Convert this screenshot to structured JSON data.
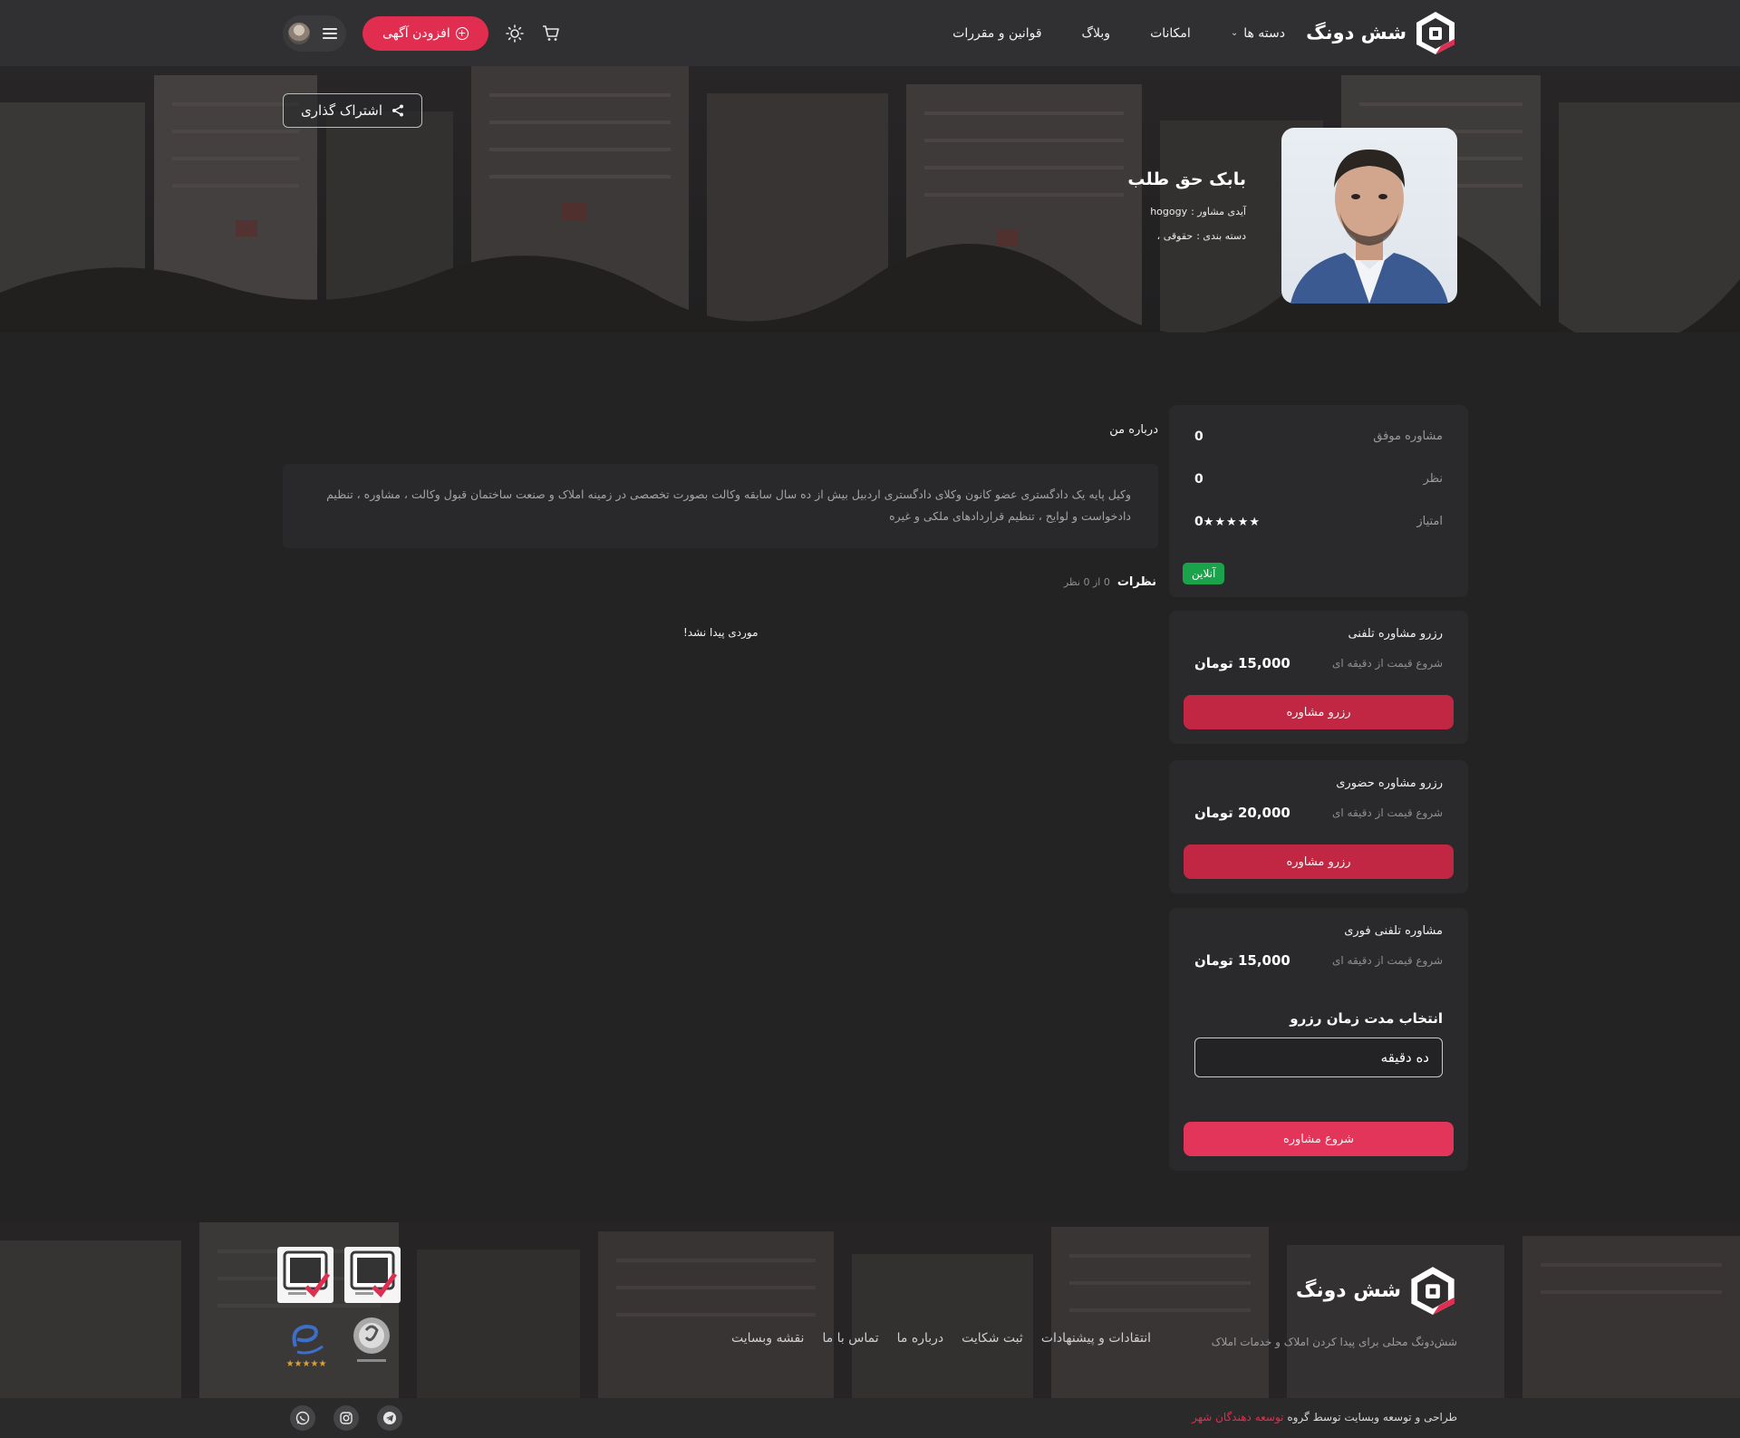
{
  "header": {
    "logo_text": "شش دونگ",
    "nav": [
      {
        "label": "دسته ها"
      },
      {
        "label": "امکانات"
      },
      {
        "label": "وبلاگ"
      },
      {
        "label": "قوانین و مقررات"
      }
    ],
    "add_ad_label": "افزودن آگهی"
  },
  "hero": {
    "share_label": "اشتراک گذاری",
    "name": "بابک حق طلب",
    "advisor_id_label": "آیدی مشاور :",
    "advisor_id": "hogogy",
    "category_label": "دسته بندی :",
    "category": "حقوقی ،"
  },
  "stats": {
    "successful_label": "مشاوره موفق",
    "successful_value": "0",
    "reviews_label": "نظر",
    "reviews_value": "0",
    "rating_label": "امتیاز",
    "rating_value": "0",
    "rating_stars": "★★★★★",
    "status": "آنلاین"
  },
  "booking": [
    {
      "title": "رزرو مشاوره تلفنی",
      "price_label": "شروع قیمت از دقیقه ای",
      "price": "15,000 تومان",
      "button": "رزرو مشاوره"
    },
    {
      "title": "رزرو مشاوره حضوری",
      "price_label": "شروع قیمت از دقیقه ای",
      "price": "20,000 تومان",
      "button": "رزرو مشاوره"
    }
  ],
  "instant": {
    "title": "مشاوره تلفنی فوری",
    "price_label": "شروع قیمت از دقیقه ای",
    "price": "15,000 تومان",
    "select_title": "انتخاب مدت زمان رزرو",
    "selected_duration": "ده دقیقه",
    "button": "شروع مشاوره"
  },
  "about": {
    "title": "درباره من",
    "text": "وکیل پایه یک دادگستری عضو کانون وکلای دادگستری اردبیل بیش از ده سال سابقه وکالت بصورت تخصصی در زمینه املاک و صنعت ساختمان قبول وکالت ، مشاوره ، تنظیم دادخواست و لوایح ، تنظیم قراردادهای ملکی و غیره"
  },
  "reviews": {
    "title": "نظرات",
    "count": "0 از 0 نظر",
    "empty": "موردی پیدا نشد!"
  },
  "footer": {
    "logo_text": "شش دونگ",
    "tagline": "شش‌دونگ محلی برای پیدا کردن املاک و خدمات املاک",
    "links": [
      "انتقادات و پیشنهادات",
      "ثبت شکایت",
      "درباره ما",
      "تماس با ما",
      "نقشه وبسایت"
    ],
    "copyright_prefix": "طراحی و توسعه وبسایت توسط گروه",
    "copyright_brand": "توسعه دهندگان شهر"
  },
  "colors": {
    "accent": "#e12d4f",
    "button_red": "#c12642",
    "online_green": "#1aa34a",
    "bg": "#232324"
  }
}
